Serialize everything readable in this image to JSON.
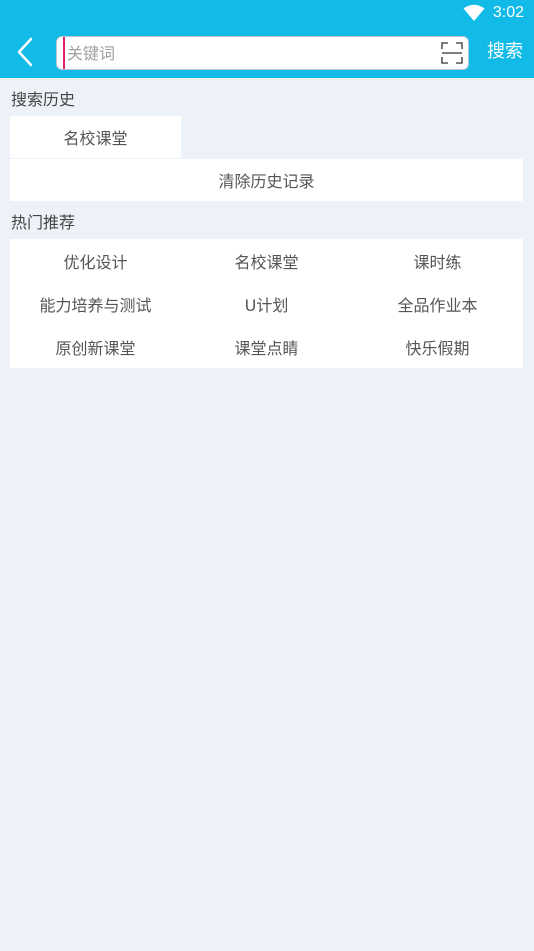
{
  "status": {
    "time": "3:02"
  },
  "search": {
    "placeholder": "关键词",
    "button_label": "搜索"
  },
  "history": {
    "title": "搜索历史",
    "items": [
      "名校课堂"
    ],
    "clear_label": "清除历史记录"
  },
  "hot": {
    "title": "热门推荐",
    "items": [
      "优化设计",
      "名校课堂",
      "课时练",
      "能力培养与测试",
      "U计划",
      "全品作业本",
      "原创新课堂",
      "课堂点睛",
      "快乐假期"
    ]
  },
  "colors": {
    "header": "#12bbe7",
    "background": "#edf2f9",
    "cursor": "#e5206b"
  }
}
